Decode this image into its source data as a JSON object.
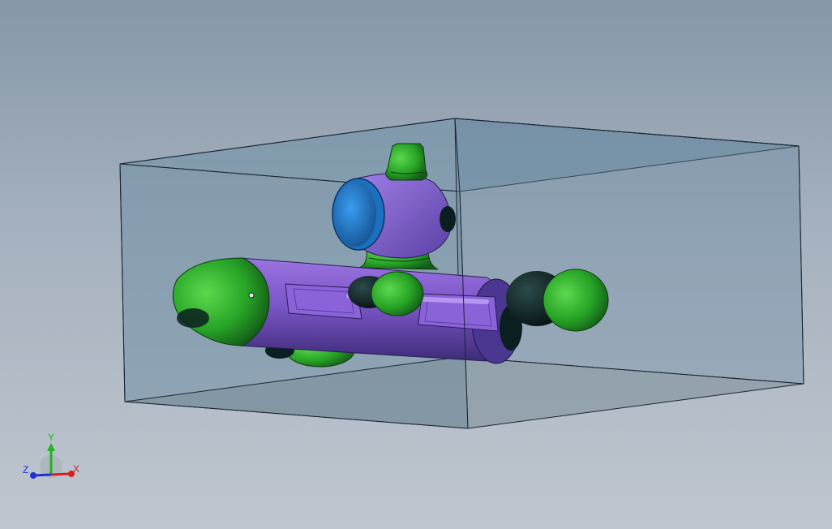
{
  "viewport": {
    "background_top": "#8797a8",
    "background_bottom": "#bfc6cf"
  },
  "model": {
    "hull_color": "#8a63d2",
    "hull_shadow": "#3e2d7a",
    "cap_color": "#2fa52a",
    "cap_dark": "#10282a",
    "lens_color": "#2a84d8",
    "bounding_box_fill": "#5b8aa6",
    "bounding_box_edge": "#1a2530"
  },
  "triad": {
    "y_label": "Y",
    "z_label": "Z",
    "x_label": "X",
    "x_color": "#d52020",
    "y_color": "#1fb51f",
    "z_color": "#2030d0"
  }
}
